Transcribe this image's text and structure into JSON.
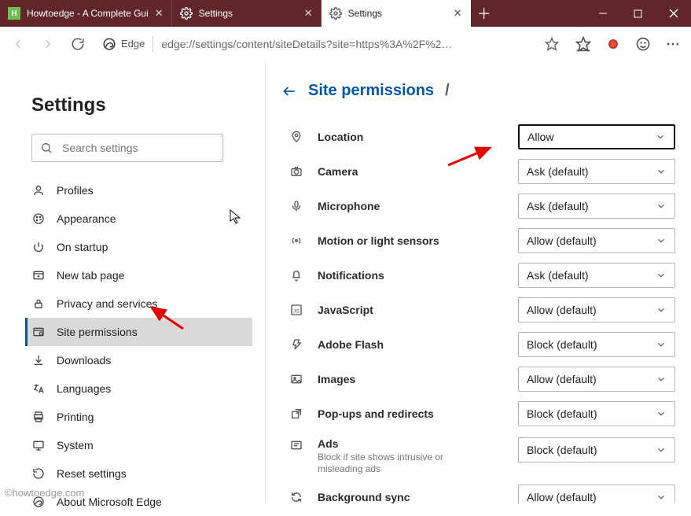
{
  "tabs": [
    {
      "label": "Howtoedge - A Complete Gui",
      "fav": "H"
    },
    {
      "label": "Settings"
    },
    {
      "label": "Settings"
    }
  ],
  "addressbar": {
    "engineLabel": "Edge",
    "url": "edge://settings/content/siteDetails?site=https%3A%2F%2…"
  },
  "sidebar": {
    "title": "Settings",
    "search_placeholder": "Search settings",
    "items": [
      {
        "label": "Profiles"
      },
      {
        "label": "Appearance"
      },
      {
        "label": "On startup"
      },
      {
        "label": "New tab page"
      },
      {
        "label": "Privacy and services"
      },
      {
        "label": "Site permissions"
      },
      {
        "label": "Downloads"
      },
      {
        "label": "Languages"
      },
      {
        "label": "Printing"
      },
      {
        "label": "System"
      },
      {
        "label": "Reset settings"
      },
      {
        "label": "About Microsoft Edge"
      }
    ]
  },
  "main": {
    "breadcrumb": "Site permissions",
    "perms": [
      {
        "label": "Location",
        "value": "Allow"
      },
      {
        "label": "Camera",
        "value": "Ask (default)"
      },
      {
        "label": "Microphone",
        "value": "Ask (default)"
      },
      {
        "label": "Motion or light sensors",
        "value": "Allow (default)"
      },
      {
        "label": "Notifications",
        "value": "Ask (default)"
      },
      {
        "label": "JavaScript",
        "value": "Allow (default)"
      },
      {
        "label": "Adobe Flash",
        "value": "Block (default)"
      },
      {
        "label": "Images",
        "value": "Allow (default)"
      },
      {
        "label": "Pop-ups and redirects",
        "value": "Block (default)"
      },
      {
        "label": "Ads",
        "sub": "Block if site shows intrusive or misleading ads",
        "value": "Block (default)"
      },
      {
        "label": "Background sync",
        "value": "Allow (default)"
      }
    ]
  },
  "watermark": "©howtoedge.com"
}
